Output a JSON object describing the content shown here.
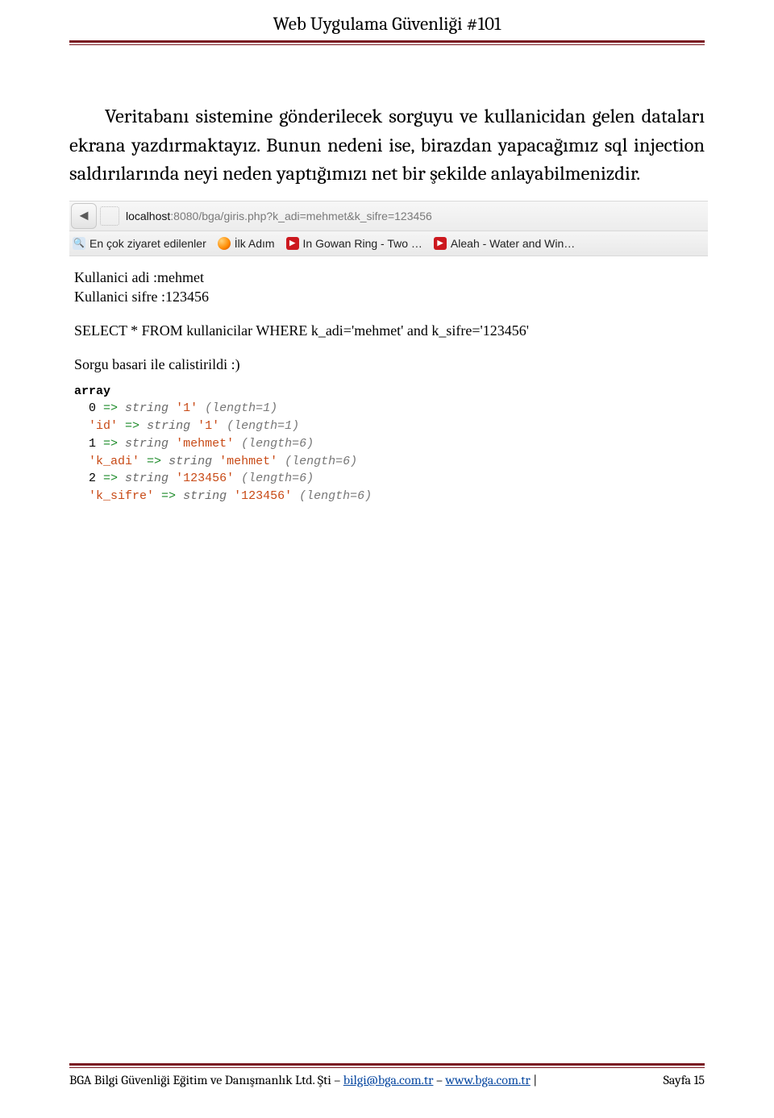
{
  "header": {
    "title": "Web Uygulama Güvenliği #101"
  },
  "paragraph": {
    "text": "Veritabanı sistemine gönderilecek sorguyu ve kullanicidan gelen dataları ekrana yazdırmaktayız. Bunun nedeni ise, birazdan yapacağımız sql injection saldırılarında neyi neden yaptığımızı net bir şekilde anlayabilmenizdir."
  },
  "browser": {
    "back_symbol": "◄",
    "url_host": "localhost",
    "url_port": ":8080",
    "url_path": "/bga/giris.php?k_adi=mehmet&k_sifre=123456",
    "bookmarks": {
      "most_visited": "En çok ziyaret edilenler",
      "first_step": "İlk Adım",
      "item3": "In Gowan Ring - Two …",
      "item4": "Aleah - Water and Win…"
    }
  },
  "output": {
    "line1": "Kullanici adi :mehmet",
    "line2": "Kullanici sifre :123456",
    "sql": "SELECT * FROM kullanicilar WHERE k_adi='mehmet' and k_sifre='123456'",
    "status": "Sorgu basari ile calistirildi :)",
    "dump": {
      "head": "array",
      "rows": [
        {
          "key": "0",
          "type": "string",
          "val": "'1'",
          "len": "(length=1)"
        },
        {
          "key": "'id'",
          "type": "string",
          "val": "'1'",
          "len": "(length=1)"
        },
        {
          "key": "1",
          "type": "string",
          "val": "'mehmet'",
          "len": "(length=6)"
        },
        {
          "key": "'k_adi'",
          "type": "string",
          "val": "'mehmet'",
          "len": "(length=6)"
        },
        {
          "key": "2",
          "type": "string",
          "val": "'123456'",
          "len": "(length=6)"
        },
        {
          "key": "'k_sifre'",
          "type": "string",
          "val": "'123456'",
          "len": "(length=6)"
        }
      ]
    }
  },
  "footer": {
    "org": "BGA Bilgi Güvenliği Eğitim ve Danışmanlık Ltd. Şti – ",
    "email": "bilgi@bga.com.tr",
    "sep": " – ",
    "site": "www.bga.com.tr",
    "pipe": " | ",
    "page_label": "Sayfa 15"
  }
}
